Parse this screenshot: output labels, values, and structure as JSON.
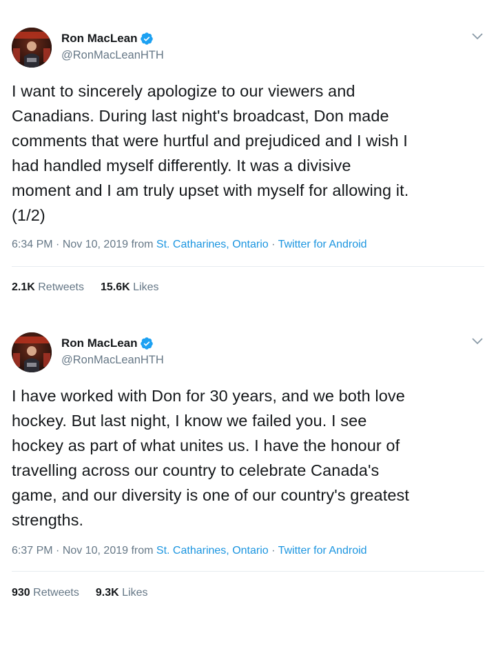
{
  "tweets": [
    {
      "author": {
        "display_name": "Ron MacLean",
        "handle": "@RonMacLeanHTH",
        "verified_icon": "verified-badge-icon",
        "avatar_icon": "avatar-photo"
      },
      "text": "I want to sincerely apologize to our viewers and\nCanadians. During last night's broadcast, Don made\ncomments that were hurtful and prejudiced and I wish I\nhad handled myself differently. It was a divisive\nmoment and I am truly upset with myself for allowing it.\n(1/2)",
      "time": "6:34 PM",
      "date": "Nov 10, 2019",
      "from_label": "from",
      "location": "St. Catharines, Ontario",
      "source": "Twitter for Android",
      "retweets_count": "2.1K",
      "retweets_label": "Retweets",
      "likes_count": "15.6K",
      "likes_label": "Likes"
    },
    {
      "author": {
        "display_name": "Ron MacLean",
        "handle": "@RonMacLeanHTH",
        "verified_icon": "verified-badge-icon",
        "avatar_icon": "avatar-photo"
      },
      "text": "I have worked with Don for 30 years, and we both love\nhockey. But last night, I know we failed you. I see\nhockey as part of what unites us. I have the honour of\ntravelling across our country to celebrate Canada's\ngame, and our diversity is one of our country's greatest\nstrengths.",
      "time": "6:37 PM",
      "date": "Nov 10, 2019",
      "from_label": "from",
      "location": "St. Catharines, Ontario",
      "source": "Twitter for Android",
      "retweets_count": "930",
      "retweets_label": "Retweets",
      "likes_count": "9.3K",
      "likes_label": "Likes"
    }
  ],
  "colors": {
    "text_primary": "#14171a",
    "text_secondary": "#657786",
    "link": "#1b95e0",
    "verified": "#1da1f2",
    "divider": "#e6ecf0"
  }
}
